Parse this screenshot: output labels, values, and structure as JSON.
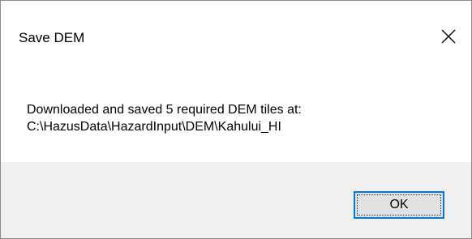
{
  "dialog": {
    "title": "Save DEM",
    "close_icon": "close-icon",
    "message_line1": "Downloaded and saved 5 required DEM tiles at:",
    "message_line2": "C:\\HazusData\\HazardInput\\DEM\\Kahului_HI",
    "ok_label": "OK"
  },
  "colors": {
    "footer": "#f0f0f0",
    "button_border": "#0078d7",
    "button_fill": "#e1e1e1"
  }
}
